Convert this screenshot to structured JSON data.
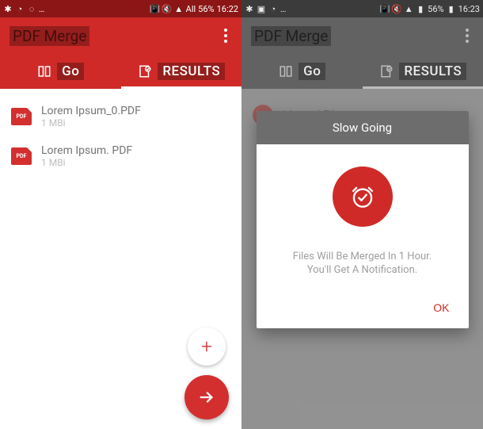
{
  "colors": {
    "primary": "#cf2a28",
    "primaryDark": "#8c1616"
  },
  "left": {
    "statusBar": {
      "battery": "56%",
      "time": "16:22",
      "misc": "All"
    },
    "appTitle": "PDF Merge",
    "tabs": {
      "go": "Go",
      "results": "RESULTS"
    },
    "files": [
      {
        "name": "Lorem Ipsum_0.PDF",
        "size": "1 MBi",
        "badge": "PDF"
      },
      {
        "name": "Lorem Ipsum. PDF",
        "size": "1 MBi",
        "badge": "PDF"
      }
    ],
    "fab": {
      "add": "+",
      "go": "→"
    }
  },
  "right": {
    "statusBar": {
      "battery": "56%",
      "time": "16:23"
    },
    "appTitle": "PDF Merge",
    "tabs": {
      "go": "Go",
      "results": "RESULTS"
    },
    "mergedFile": "Merged File",
    "dialog": {
      "title": "Slow Going",
      "line1": "Files Will Be Merged In 1 Hour.",
      "line2": "You'll Get A Notification.",
      "ok": "OK"
    }
  }
}
